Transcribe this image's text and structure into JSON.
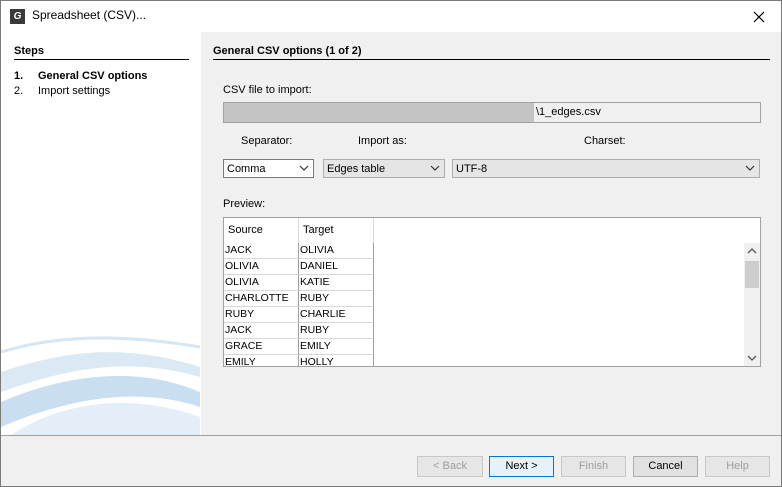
{
  "window": {
    "title": "Spreadsheet (CSV)...",
    "app_icon_glyph": "G"
  },
  "steps": {
    "title": "Steps",
    "items": [
      {
        "num": "1.",
        "label": "General CSV options"
      },
      {
        "num": "2.",
        "label": "Import settings"
      }
    ]
  },
  "main": {
    "title": "General CSV options (1 of 2)",
    "file_label": "CSV file to import:",
    "file_value": "\\1_edges.csv",
    "separator_label": "Separator:",
    "import_as_label": "Import as:",
    "charset_label": "Charset:",
    "separator_value": "Comma",
    "import_as_value": "Edges table",
    "charset_value": "UTF-8",
    "preview_label": "Preview:"
  },
  "preview": {
    "columns": [
      "Source",
      "Target"
    ],
    "rows": [
      [
        "JACK",
        "OLIVIA"
      ],
      [
        "OLIVIA",
        "DANIEL"
      ],
      [
        "OLIVIA",
        "KATIE"
      ],
      [
        "CHARLOTTE",
        "RUBY"
      ],
      [
        "RUBY",
        "CHARLIE"
      ],
      [
        "JACK",
        "RUBY"
      ],
      [
        "GRACE",
        "EMILY"
      ],
      [
        "EMILY",
        "HOLLY"
      ]
    ]
  },
  "buttons": {
    "back": "< Back",
    "next": "Next >",
    "finish": "Finish",
    "cancel": "Cancel",
    "help": "Help"
  },
  "colors": {
    "accent": "#0078d7",
    "swoosh": "#cfe3f3"
  }
}
